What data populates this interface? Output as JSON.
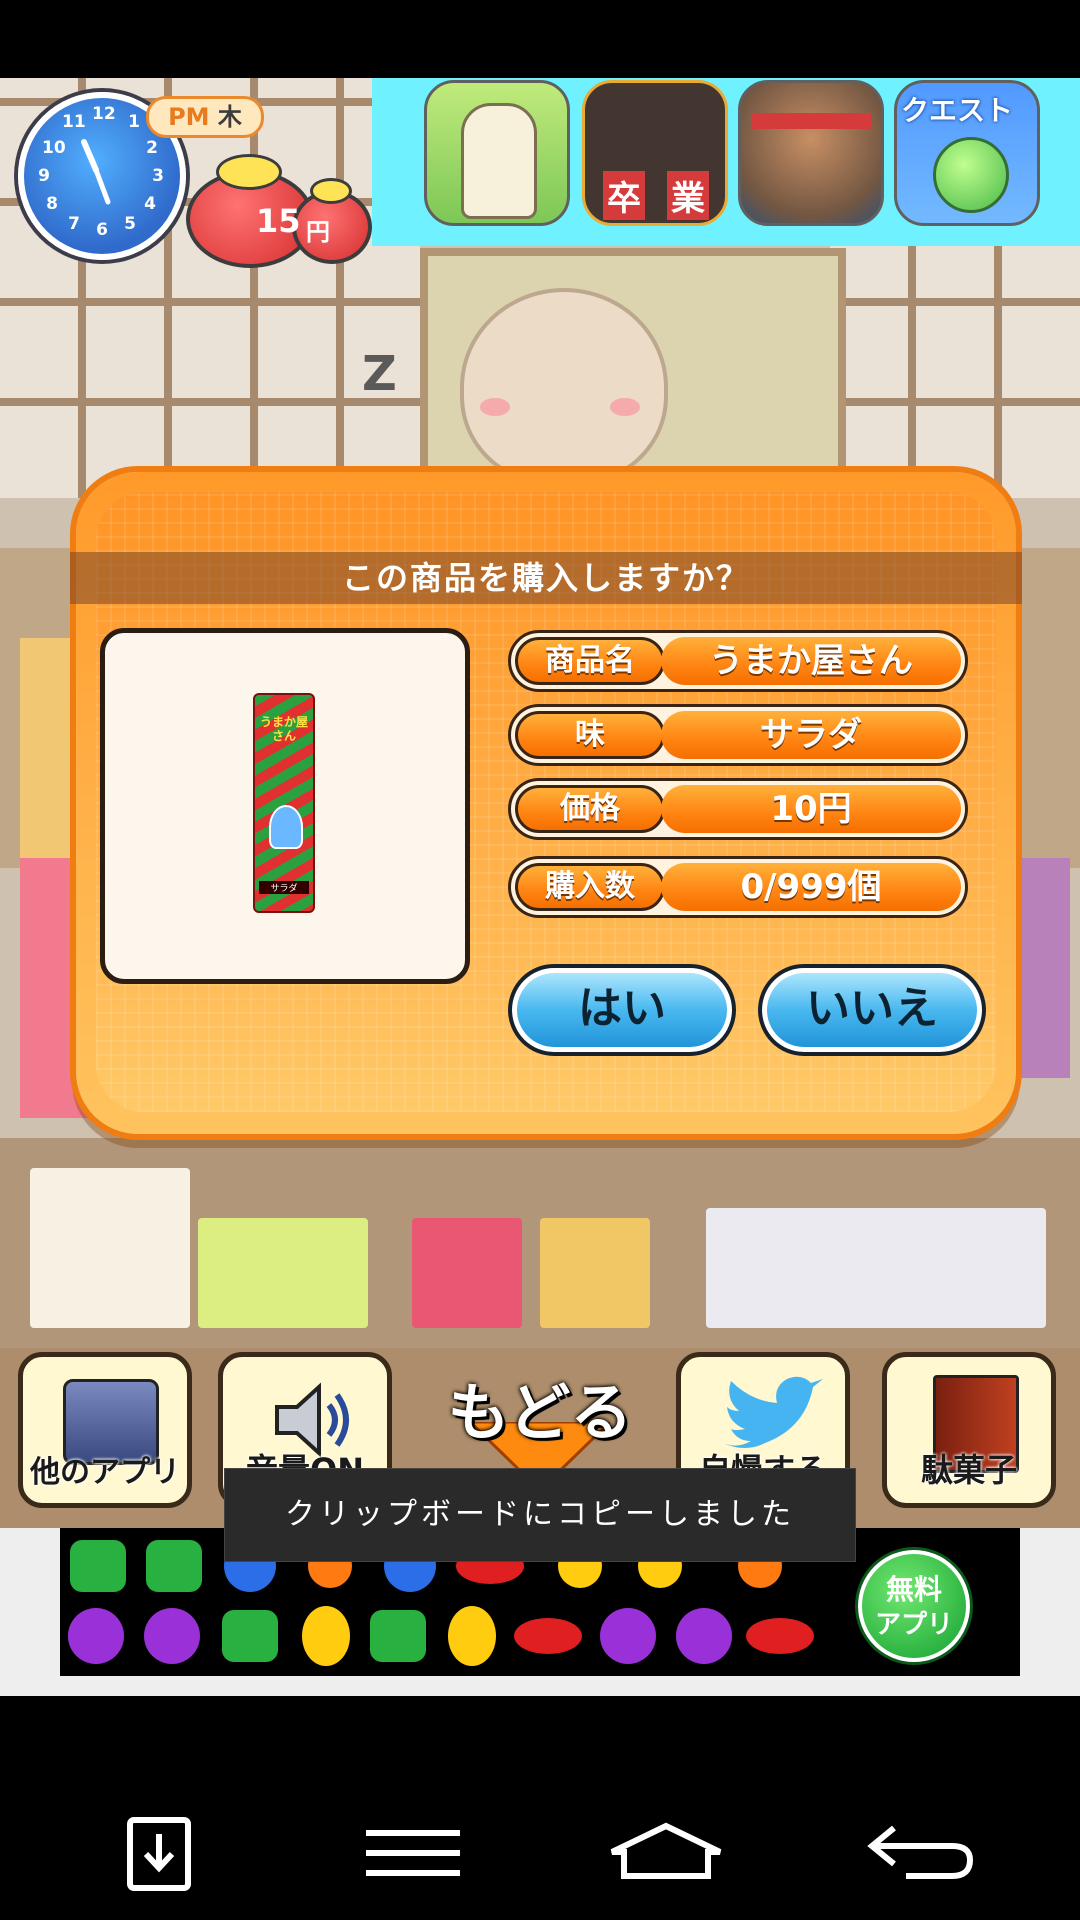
{
  "hud": {
    "clock_numbers": [
      "12",
      "1",
      "2",
      "3",
      "4",
      "5",
      "6",
      "7",
      "8",
      "9",
      "10",
      "11"
    ],
    "period": "PM",
    "weekday": "木",
    "money_amount": "15",
    "money_unit": "円"
  },
  "ad_banner": {
    "icons": [
      "giraffe-app-icon",
      "graduation-game-icon",
      "warrior-game-icon",
      "quest-game-icon"
    ],
    "quest_text": "クエスト",
    "graduation_text_1": "卒",
    "graduation_text_2": "業"
  },
  "scene": {
    "sleep_mark": "Z"
  },
  "dialog": {
    "title": "この商品を購入しますか？",
    "product": {
      "package_brand": "うまか屋さん",
      "package_flavor": "サラダ"
    },
    "fields": [
      {
        "label": "商品名",
        "value": "うまか屋さん"
      },
      {
        "label": "味",
        "value": "サラダ"
      },
      {
        "label": "価格",
        "value": "10円"
      },
      {
        "label": "購入数",
        "value": "0/999個"
      }
    ],
    "yes_label": "はい",
    "no_label": "いいえ"
  },
  "menu": {
    "other_apps": "他のアプリ",
    "sound": "音量ON",
    "back": "もどる",
    "share": "自慢する",
    "dagashi": "駄菓子"
  },
  "toast": "クリップボードにコピーしました",
  "ad_bottom": {
    "free_app_line1": "無料",
    "free_app_line2": "アプリ"
  },
  "colors": {
    "dialog_orange": "#ff9425",
    "button_blue": "#49b8f0",
    "ad_cyan": "#5df0ff"
  }
}
